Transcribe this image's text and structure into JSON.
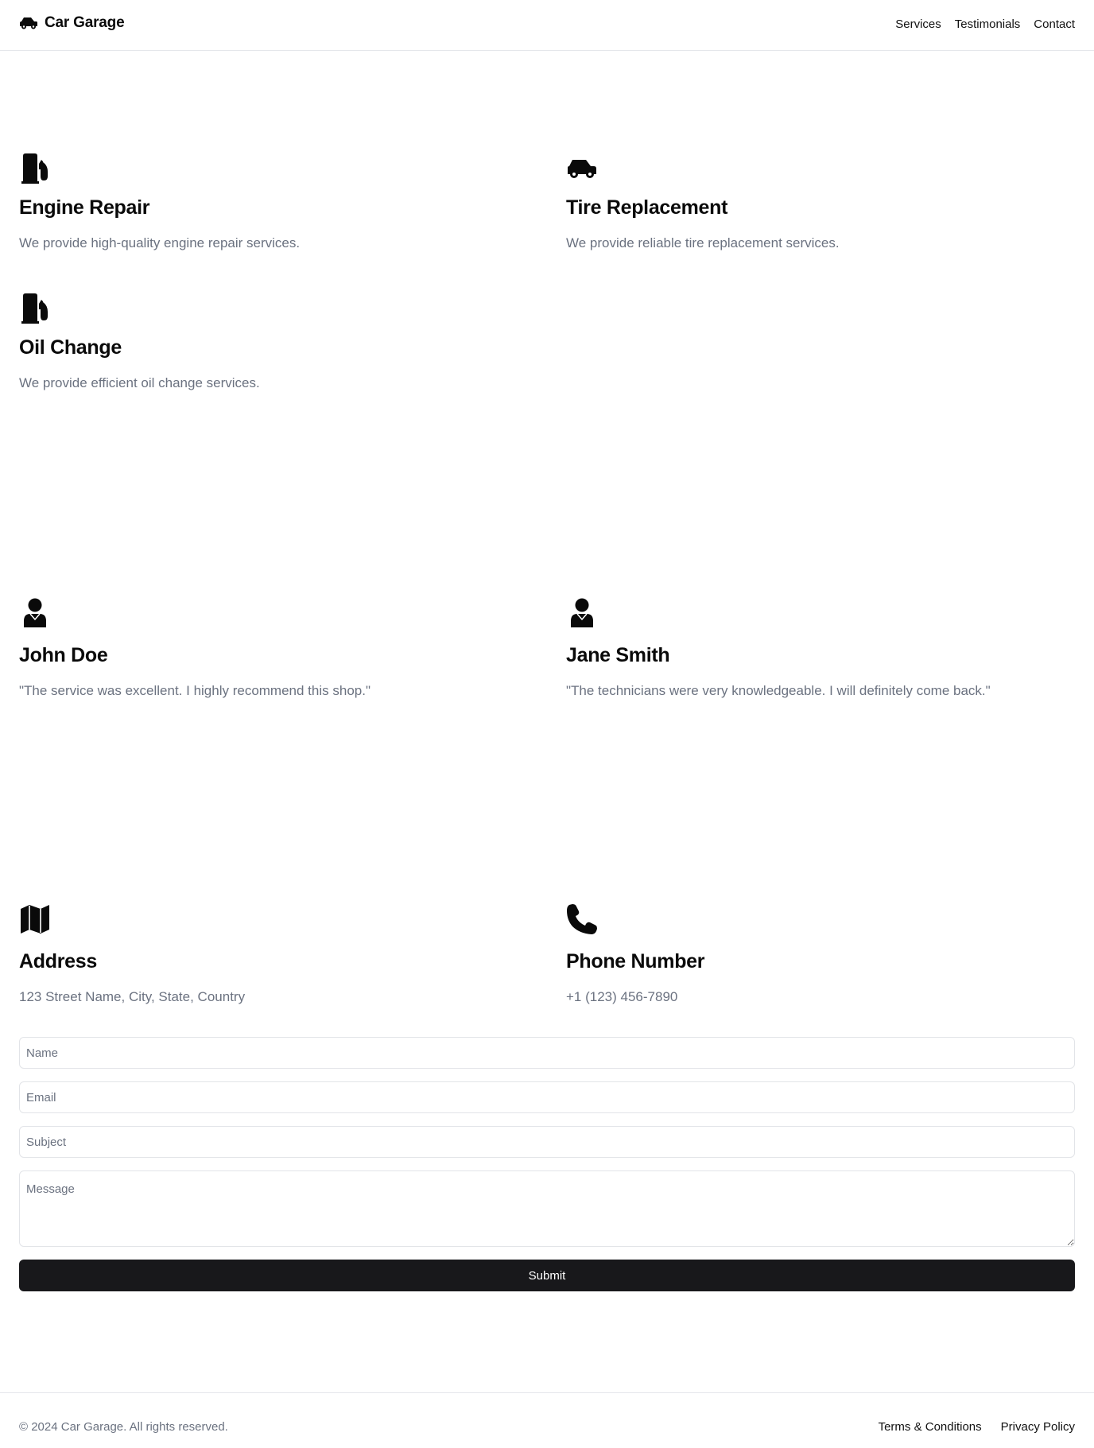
{
  "header": {
    "brand": "Car Garage",
    "nav": [
      "Services",
      "Testimonials",
      "Contact"
    ]
  },
  "services": [
    {
      "icon": "fuel-pump-icon",
      "title": "Engine Repair",
      "description": "We provide high-quality engine repair services."
    },
    {
      "icon": "car-icon",
      "title": "Tire Replacement",
      "description": "We provide reliable tire replacement services."
    },
    {
      "icon": "fuel-pump-icon",
      "title": "Oil Change",
      "description": "We provide efficient oil change services."
    }
  ],
  "testimonials": [
    {
      "icon": "user-icon",
      "name": "John Doe",
      "quote": "\"The service was excellent. I highly recommend this shop.\""
    },
    {
      "icon": "user-icon",
      "name": "Jane Smith",
      "quote": "\"The technicians were very knowledgeable. I will definitely come back.\""
    }
  ],
  "contact": {
    "address": {
      "icon": "map-icon",
      "title": "Address",
      "value": "123 Street Name, City, State, Country"
    },
    "phone": {
      "icon": "phone-icon",
      "title": "Phone Number",
      "value": "+1 (123) 456-7890"
    }
  },
  "form": {
    "name_placeholder": "Name",
    "email_placeholder": "Email",
    "subject_placeholder": "Subject",
    "message_placeholder": "Message",
    "submit_label": "Submit"
  },
  "footer": {
    "copyright": "© 2024 Car Garage. All rights reserved.",
    "links": [
      "Terms & Conditions",
      "Privacy Policy"
    ]
  },
  "colors": {
    "text": "#0a0a0a",
    "muted": "#6b7280",
    "border": "#e5e7eb",
    "button": "#18181b"
  }
}
